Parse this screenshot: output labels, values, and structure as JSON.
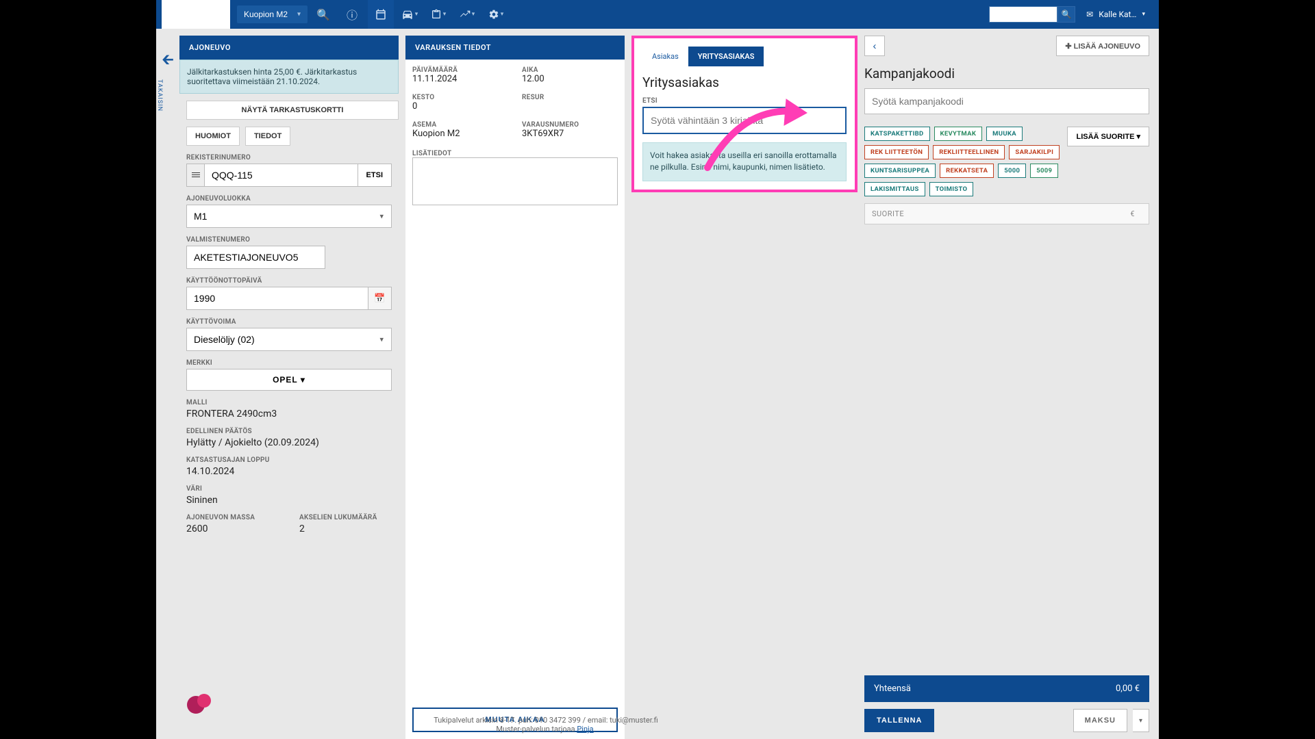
{
  "header": {
    "location": "Kuopion M2",
    "user": "Kalle Kat…"
  },
  "back": {
    "label": "TAKAISIN"
  },
  "vehicle": {
    "tab": "AJONEUVO",
    "notice": "Jälkitarkastuksen hinta 25,00 €. Järkitarkastus suoritettava viimeistään 21.10.2024.",
    "show_card": "NÄYTÄ TARKASTUSKORTTI",
    "huomiot": "HUOMIOT",
    "tiedot": "TIEDOT",
    "reg_label": "REKISTERINUMERO",
    "reg": "QQQ-115",
    "etsi": "ETSI",
    "class_label": "AJONEUVOLUOKKA",
    "class": "M1",
    "vin_label": "VALMISTENUMERO",
    "vin": "AKETESTIAJONEUVO5",
    "use_label": "KÄYTTÖÖNOTTOPÄIVÄ",
    "use": "1990",
    "fuel_label": "KÄYTTÖVOIMA",
    "fuel": "Dieselöljy (02)",
    "make_label": "MERKKI",
    "make": "OPEL  ▾",
    "model_label": "MALLI",
    "model": "FRONTERA 2490cm3",
    "prev_label": "EDELLINEN PÄÄTÖS",
    "prev": "Hylätty / Ajokielto (20.09.2024)",
    "insp_label": "KATSASTUSAJAN LOPPU",
    "insp": "14.10.2024",
    "color_label": "VÄRI",
    "color": "Sininen",
    "mass_label": "AJONEUVON MASSA",
    "mass": "2600",
    "axles_label": "AKSELIEN LUKUMÄÄRÄ",
    "axles": "2"
  },
  "booking": {
    "tab": "VARAUKSEN TIEDOT",
    "date_label": "PÄIVÄMÄÄRÄ",
    "date": "11.11.2024",
    "time_label": "AIKA",
    "time": "12.00",
    "dur_label": "KESTO",
    "dur": "0",
    "res_label": "RESUR",
    "station_label": "ASEMA",
    "station": "Kuopion M2",
    "no_label": "VARAUSNUMERO",
    "no": "3KT69XR7",
    "extra_label": "LISÄTIEDOT",
    "change": "MUUTA AIKAA"
  },
  "customer": {
    "tab_person": "Asiakas",
    "tab_company": "YRITYSASIAKAS",
    "title": "Yritysasiakas",
    "search_label": "ETSI",
    "search_placeholder": "Syötä vähintään 3 kirjainta",
    "hint": "Voit hakea asiakasta useilla eri sanoilla erottamalla ne pilkulla. Esim. nimi, kaupunki, nimen lisätieto."
  },
  "right": {
    "add_vehicle": "✚ LISÄÄ AJONEUVO",
    "campaign_title": "Kampanjakoodi",
    "campaign_placeholder": "Syötä kampanjakoodi",
    "lisaa_suorite": "LISÄÄ SUORITE ▾",
    "tags": [
      "KATSPAKETTIBD",
      "KEVYTMAK",
      "MUUKA",
      "REK LIITTEETÖN",
      "REKLIITTEELLINEN",
      "SARJAKILPI",
      "KUNTSARISUPPEA",
      "REKKATSETA",
      "5000",
      "5009",
      "LAKISMITTAUS",
      "TOIMISTO"
    ],
    "tag_colors": [
      "teal",
      "teal2",
      "teal",
      "red",
      "red",
      "red",
      "teal",
      "red",
      "teal",
      "teal2",
      "teal",
      "teal"
    ],
    "suorite": "SUORITE",
    "eur": "€",
    "total_label": "Yhteensä",
    "total": "0,00 €",
    "save": "TALLENNA",
    "pay": "MAKSU"
  },
  "footer": {
    "line1": "Tukipalvelut arkisin 8-17. puh: 010 3472 399 / email: tuki@muster.fi",
    "line2a": "Muster-palvelun tarjoaa ",
    "line2b": "Pinja"
  }
}
